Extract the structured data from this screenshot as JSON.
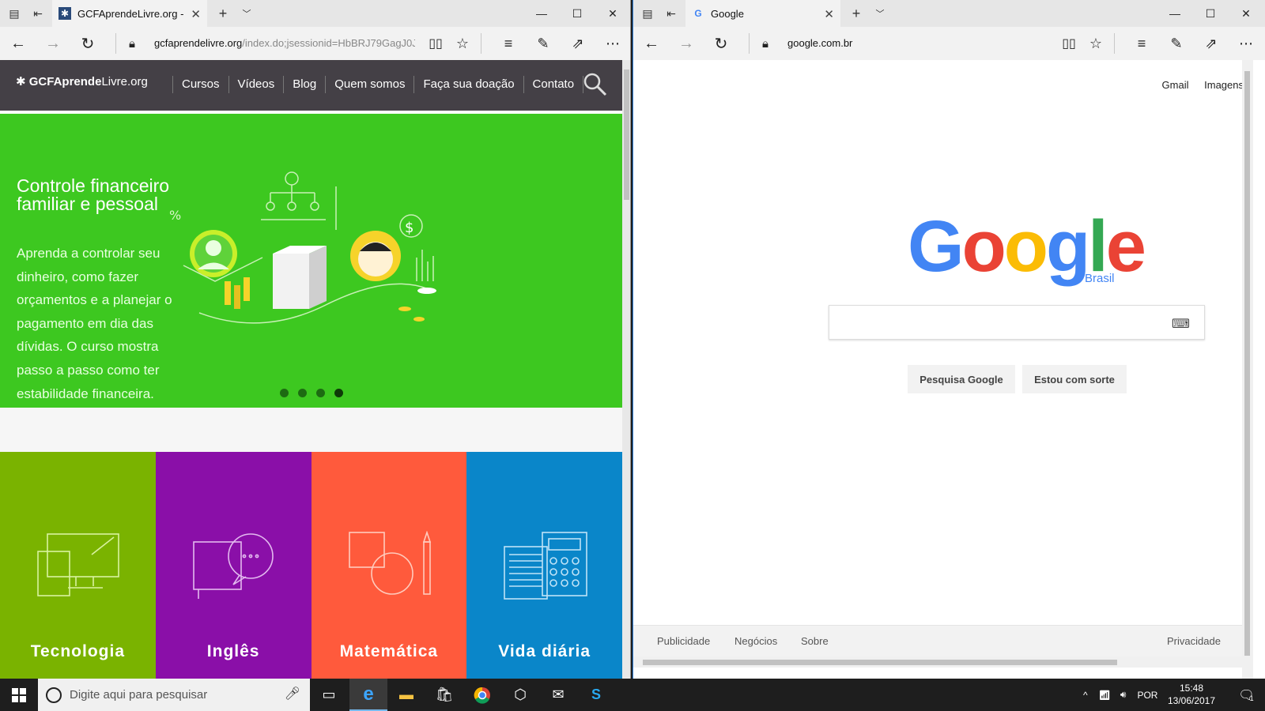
{
  "left_window": {
    "tab_title": "GCFAprendeLivre.org - ",
    "url_main": "gcfaprendelivre.org",
    "url_rest": "/index.do;jsessionid=HbBRJ79GagJ0JF",
    "site": {
      "logo_bold": "GCFAprende",
      "logo_thin": "Livre.org",
      "menu": [
        "Cursos",
        "Vídeos",
        "Blog",
        "Quem somos",
        "Faça sua doação",
        "Contato"
      ],
      "hero_title": "Controle financeiro familiar e pessoal",
      "hero_text": "Aprenda a controlar seu dinheiro, como fazer orçamentos e a planejar o pagamento em dia das dívidas. O curso mostra passo a passo como ter estabilidade financeira.",
      "slides": 4,
      "active_slide": 4,
      "tiles": [
        {
          "label": "Tecnologia",
          "color": "#7ab300"
        },
        {
          "label": "Inglês",
          "color": "#8a0fa8"
        },
        {
          "label": "Matemática",
          "color": "#ff5a3c"
        },
        {
          "label": "Vida diária",
          "color": "#0a86c9"
        }
      ]
    }
  },
  "right_window": {
    "tab_title": "Google",
    "url": "google.com.br",
    "site": {
      "top_links": [
        "Gmail",
        "Imagens"
      ],
      "logo_letters": [
        {
          "ch": "G",
          "color": "#4285f4"
        },
        {
          "ch": "o",
          "color": "#ea4335"
        },
        {
          "ch": "o",
          "color": "#fbbc05"
        },
        {
          "ch": "g",
          "color": "#4285f4"
        },
        {
          "ch": "l",
          "color": "#34a853"
        },
        {
          "ch": "e",
          "color": "#ea4335"
        }
      ],
      "country": "Brasil",
      "search_button": "Pesquisa Google",
      "lucky_button": "Estou com sorte",
      "footer_left": [
        "Publicidade",
        "Negócios",
        "Sobre"
      ],
      "footer_right": "Privacidade"
    }
  },
  "taskbar": {
    "search_placeholder": "Digite aqui para pesquisar",
    "language": "POR",
    "time": "15:48",
    "date": "13/06/2017",
    "notification_count": "1"
  }
}
